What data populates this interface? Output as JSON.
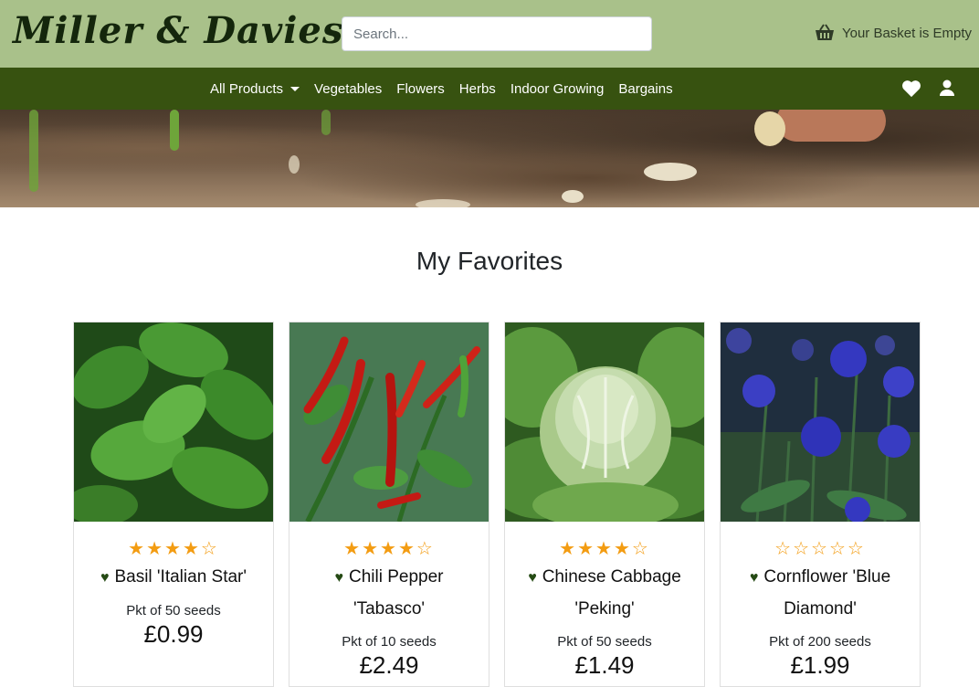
{
  "header": {
    "logo": "Miller & Davies",
    "search_placeholder": "Search...",
    "basket_label": "Your Basket is Empty"
  },
  "nav": {
    "items": [
      "All Products",
      "Vegetables",
      "Flowers",
      "Herbs",
      "Indoor Growing",
      "Bargains"
    ]
  },
  "main": {
    "title": "My Favorites"
  },
  "products": [
    {
      "name": "Basil 'Italian Star'",
      "rating": 4,
      "pack": "Pkt of 50 seeds",
      "price": "£0.99"
    },
    {
      "name": "Chili Pepper 'Tabasco'",
      "rating": 4,
      "pack": "Pkt of 10 seeds",
      "price": "£2.49"
    },
    {
      "name": "Chinese Cabbage 'Peking'",
      "rating": 4,
      "pack": "Pkt of 50 seeds",
      "price": "£1.49"
    },
    {
      "name": "Cornflower 'Blue Diamond'",
      "rating": 0,
      "pack": "Pkt of 200 seeds",
      "price": "£1.99"
    }
  ],
  "colors": {
    "header_bg": "#a9c18a",
    "nav_bg": "#375210",
    "star": "#f39c12",
    "heart": "#254a14"
  },
  "icons": [
    "basket-icon",
    "heart-icon",
    "user-icon",
    "caret-down-icon",
    "star-icon",
    "favorite-heart-icon"
  ]
}
